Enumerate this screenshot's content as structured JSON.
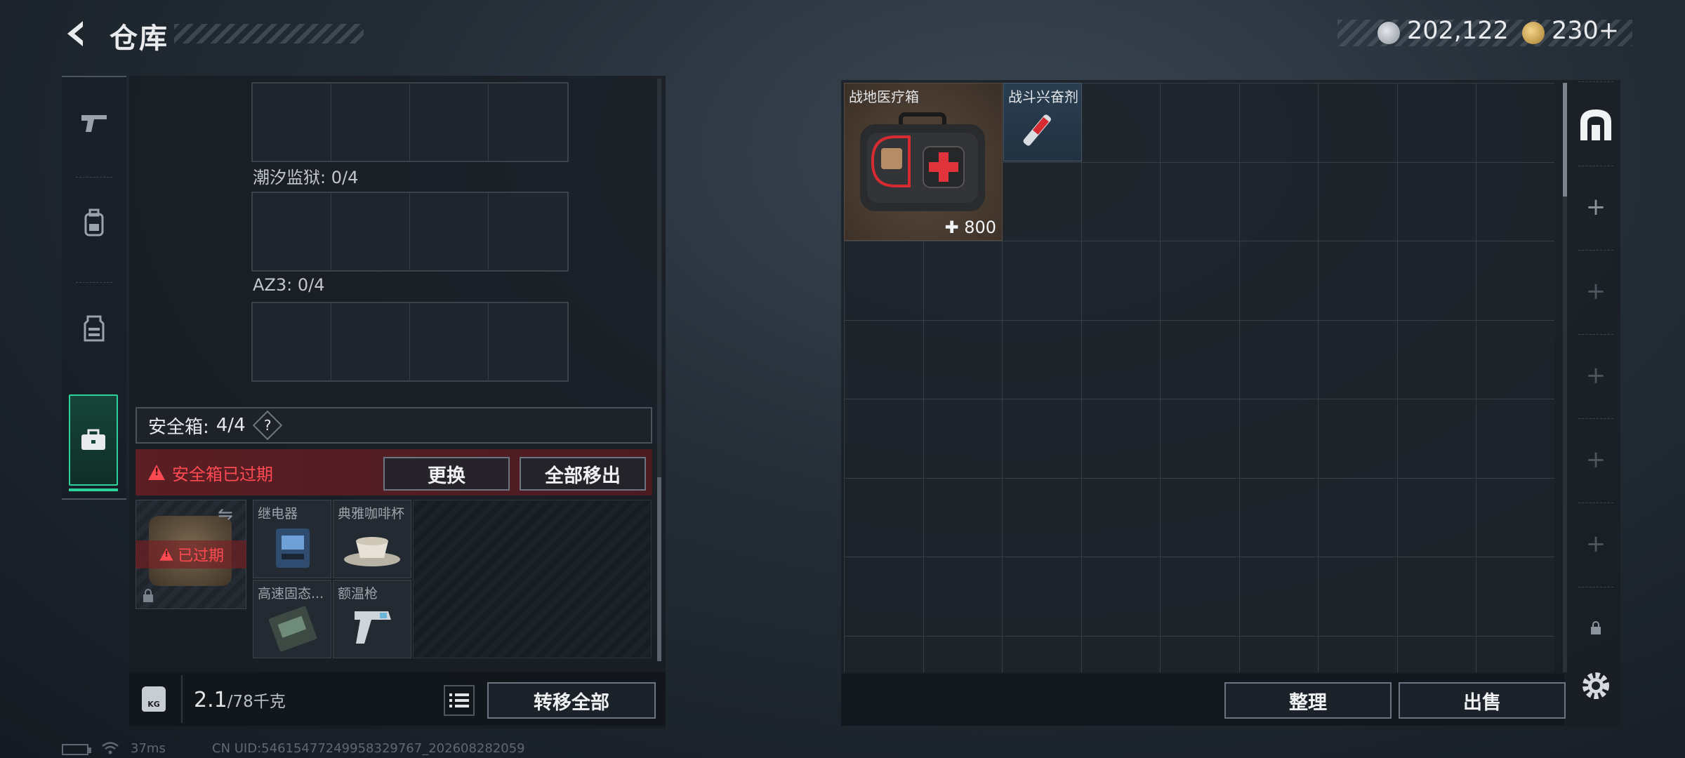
{
  "header": {
    "title": "仓库",
    "currency": [
      {
        "icon": "silver-coin-icon",
        "value": "202,122"
      },
      {
        "icon": "gold-coin-icon",
        "value": "230+"
      }
    ]
  },
  "sidebar": {
    "tabs": [
      {
        "icon": "pistol-icon",
        "active": false
      },
      {
        "icon": "backpack-icon",
        "active": false
      },
      {
        "icon": "vest-icon",
        "active": false
      },
      {
        "icon": "briefcase-icon",
        "active": true
      }
    ]
  },
  "containers": {
    "label_1": "潮汐监狱: 0/4",
    "label_2": "AZ3: 0/4"
  },
  "safe_box": {
    "label": "安全箱:",
    "count": "4/4",
    "help": "?",
    "expired_notice": "安全箱已过期",
    "swap_label": "更换",
    "move_all_label": "全部移出",
    "case_status": "已过期",
    "items": [
      {
        "name": "继电器"
      },
      {
        "name": "典雅咖啡杯"
      },
      {
        "name": "高速固态..."
      },
      {
        "name": "额温枪"
      }
    ]
  },
  "weight": {
    "icon_label": "KG",
    "current": "2.1",
    "max": "/78千克",
    "transfer_label": "转移全部"
  },
  "status": {
    "ping": "37ms",
    "uid": "CN UID:54615477249958329767_202608282059"
  },
  "stash": {
    "items": [
      {
        "name": "战地医疗箱",
        "count": "800"
      },
      {
        "name": "战斗兴奋剂"
      }
    ],
    "sort_label": "整理",
    "sell_label": "出售"
  },
  "colors": {
    "accent_green": "#2bd39a",
    "warning_red": "#ff4a52"
  }
}
